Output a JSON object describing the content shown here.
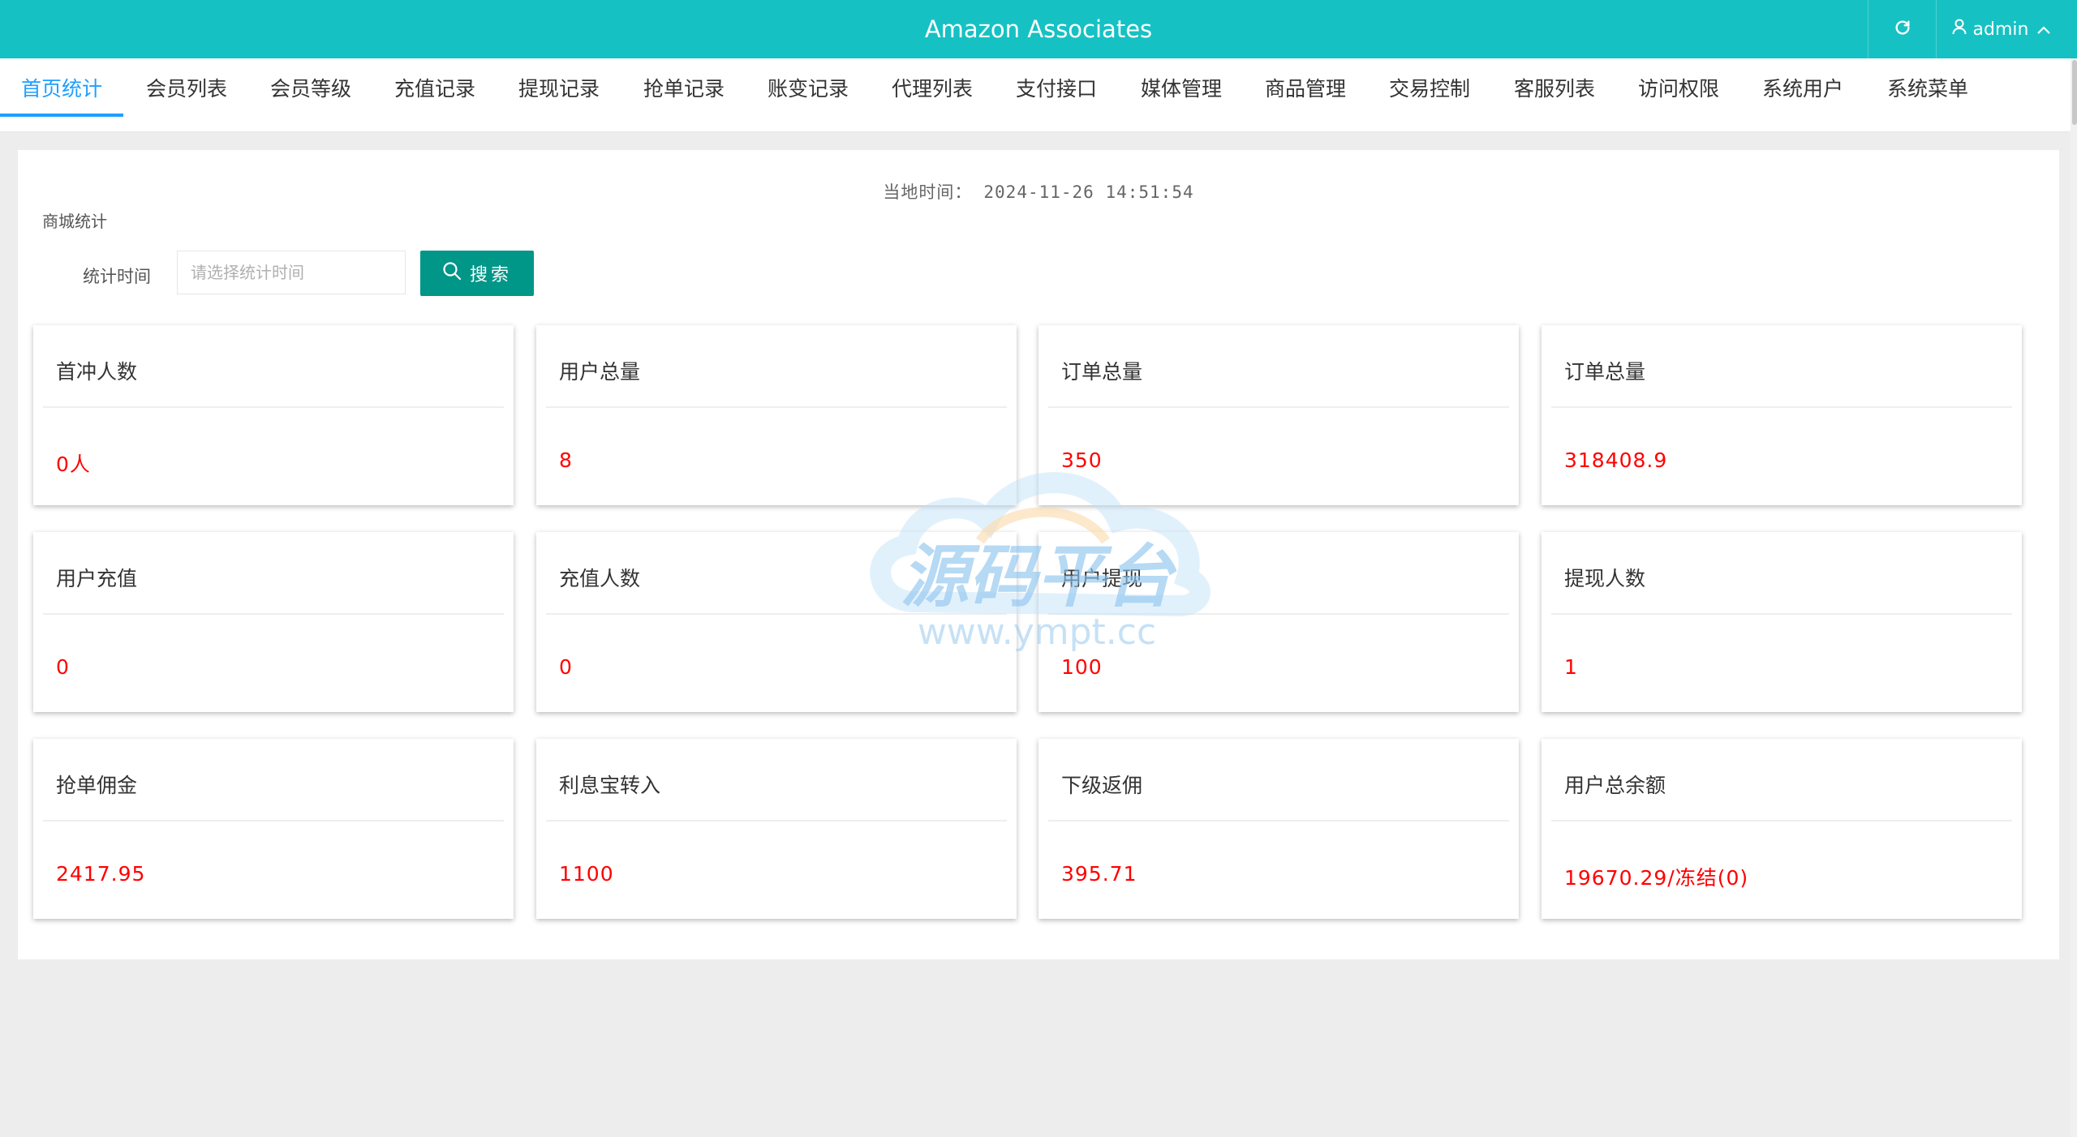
{
  "header": {
    "title": "Amazon Associates",
    "user": "admin",
    "refresh_icon": "refresh-icon",
    "user_icon": "user-icon",
    "chevron_icon": "chevron-up-icon",
    "bg_color": "#16c1c3"
  },
  "tabs": [
    {
      "label": "首页统计",
      "active": true
    },
    {
      "label": "会员列表"
    },
    {
      "label": "会员等级"
    },
    {
      "label": "充值记录"
    },
    {
      "label": "提现记录"
    },
    {
      "label": "抢单记录"
    },
    {
      "label": "账变记录"
    },
    {
      "label": "代理列表"
    },
    {
      "label": "支付接口"
    },
    {
      "label": "媒体管理"
    },
    {
      "label": "商品管理"
    },
    {
      "label": "交易控制"
    },
    {
      "label": "客服列表"
    },
    {
      "label": "访问权限"
    },
    {
      "label": "系统用户"
    },
    {
      "label": "系统菜单"
    }
  ],
  "panel": {
    "local_time_label": "当地时间：",
    "local_time_value": "2024-11-26 14:51:54",
    "section_label": "商城统计",
    "filter_label": "统计时间",
    "filter_placeholder": "请选择统计时间",
    "search_label": "搜索",
    "search_icon": "search-icon",
    "search_color": "#009688",
    "value_color": "#ff0000"
  },
  "cards": [
    {
      "title": "首冲人数",
      "value": "0人"
    },
    {
      "title": "用户总量",
      "value": "8"
    },
    {
      "title": "订单总量",
      "value": "350"
    },
    {
      "title": "订单总量",
      "value": "318408.9"
    },
    {
      "title": "用户充值",
      "value": "0"
    },
    {
      "title": "充值人数",
      "value": "0"
    },
    {
      "title": "用户提现",
      "value": "100"
    },
    {
      "title": "提现人数",
      "value": "1"
    },
    {
      "title": "抢单佣金",
      "value": "2417.95"
    },
    {
      "title": "利息宝转入",
      "value": "1100"
    },
    {
      "title": "下级返佣",
      "value": "395.71"
    },
    {
      "title": "用户总余额",
      "value": "19670.29/冻结(0)"
    }
  ],
  "watermark": {
    "main_text": "源码平台",
    "sub_text": "www.ympt.cc"
  }
}
